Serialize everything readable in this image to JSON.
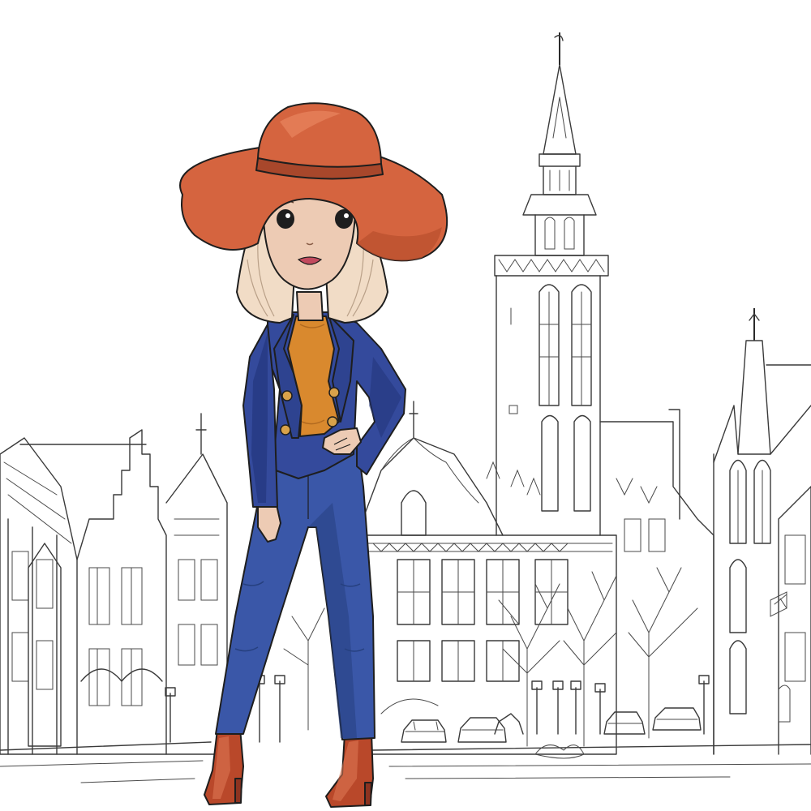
{
  "palette": {
    "background": "#ffffff",
    "sketch_line": "#3a3a3a",
    "hat": "#d5643f",
    "hat_shadow": "#b84e2e",
    "hat_band": "#a8472b",
    "hair": "#f1dcc6",
    "hair_line": "#b9a088",
    "skin": "#edcbb4",
    "blazer": "#344a9c",
    "blazer_dark": "#22347a",
    "sweater": "#d9892e",
    "jeans": "#3a57a8",
    "jeans_dark": "#26407f",
    "boots": "#b9482a",
    "buttons": "#d9a24a",
    "lips": "#c24a5e"
  },
  "scene": {
    "subject": "fashion-girl",
    "background": "city-sketch"
  }
}
